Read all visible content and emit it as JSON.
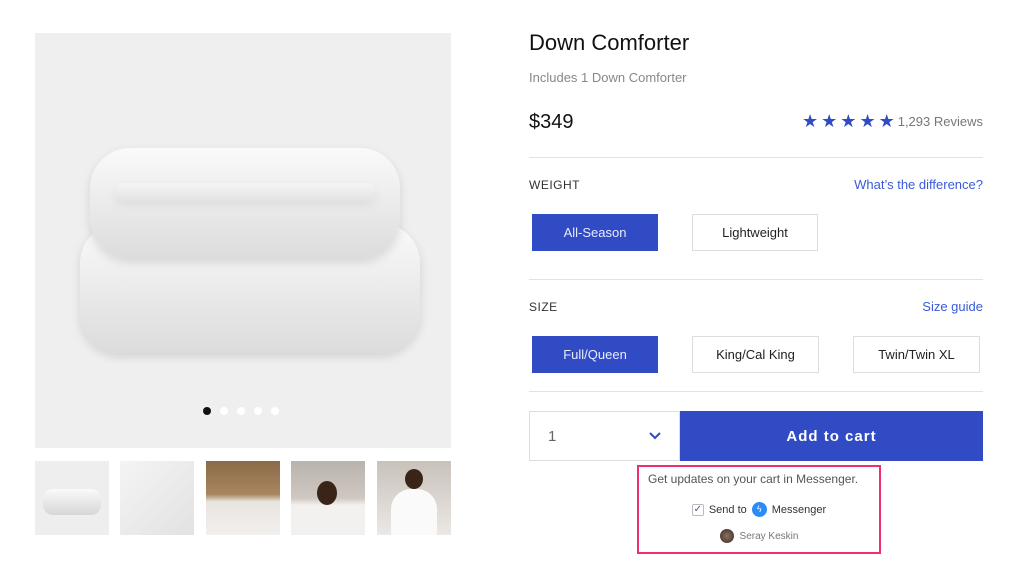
{
  "product": {
    "title": "Down Comforter",
    "subtitle": "Includes 1 Down Comforter",
    "price": "$349",
    "rating": 5,
    "reviews": "1,293 Reviews"
  },
  "gallery": {
    "active_index": 0,
    "dot_count": 5,
    "thumbnails": [
      "comforter-folded",
      "comforter-detail",
      "bedroom",
      "woman-in-bed",
      "woman-wrapped"
    ]
  },
  "weight": {
    "label": "WEIGHT",
    "link": "What’s the difference?",
    "options": [
      "All-Season",
      "Lightweight"
    ],
    "selected": "All-Season"
  },
  "size": {
    "label": "SIZE",
    "link": "Size guide",
    "options": [
      "Full/Queen",
      "King/Cal King",
      "Twin/Twin XL"
    ],
    "selected": "Full/Queen"
  },
  "cart": {
    "quantity": "1",
    "add_label": "Add to cart"
  },
  "messenger": {
    "prompt": "Get updates on your cart in Messenger.",
    "send_to": "Send to",
    "brand": "Messenger",
    "checked": true,
    "user": "Seray Keskin"
  },
  "colors": {
    "accent": "#304bc4",
    "highlight": "#f0306a"
  }
}
